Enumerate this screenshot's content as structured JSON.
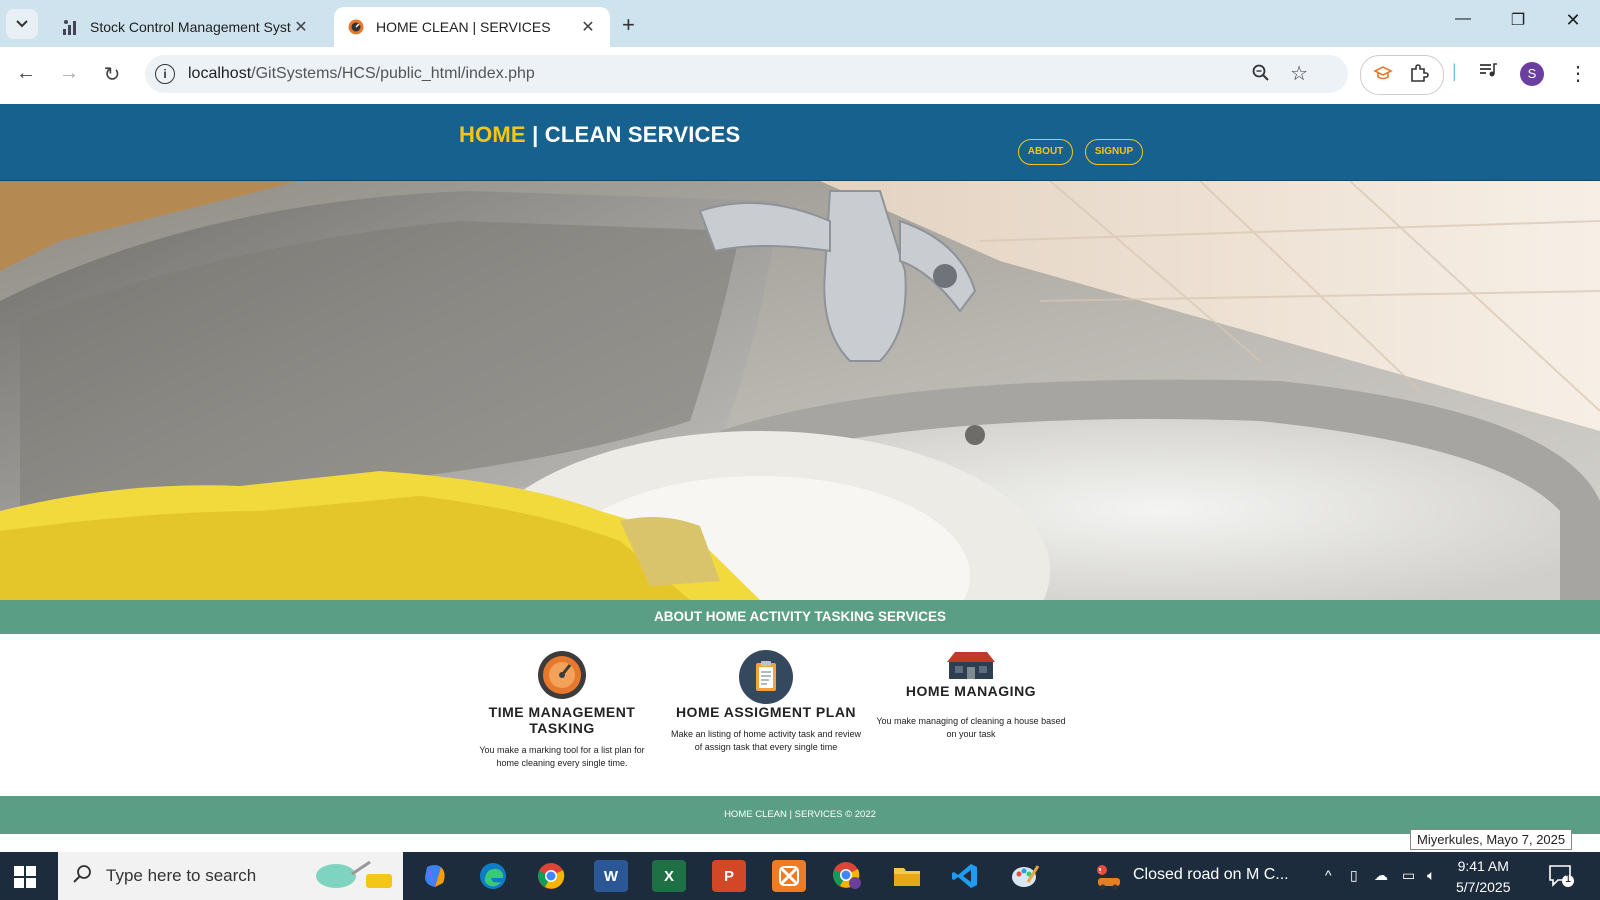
{
  "browser": {
    "tabs": [
      {
        "title": "Stock Control Management System",
        "active": false,
        "favicon": "bar-chart-icon"
      },
      {
        "title": "HOME CLEAN | SERVICES",
        "active": true,
        "favicon": "site-favicon-icon"
      }
    ],
    "url_host": "localhost",
    "url_path": "/GitSystems/HCS/public_html/index.php",
    "profile_initial": "S"
  },
  "site": {
    "logo_home": "HOME",
    "logo_rest": " | CLEAN SERVICES",
    "nav": [
      {
        "label": "ABOUT"
      },
      {
        "label": "SIGNUP"
      }
    ],
    "about_heading": "ABOUT HOME ACTIVITY TASKING SERVICES",
    "features": [
      {
        "title": "TIME MANAGEMENT TASKING",
        "text": "You make a marking tool for a list plan for home cleaning every single time.",
        "icon": "clock-icon"
      },
      {
        "title": "HOME ASSIGMENT PLAN",
        "text": "Make an listing of home activity task and review of assign task that every single time",
        "icon": "clipboard-icon"
      },
      {
        "title": "HOME MANAGING",
        "text": "You make managing of cleaning a house based on your task",
        "icon": "house-icon"
      }
    ],
    "footer": "HOME CLEAN | SERVICES © 2022"
  },
  "taskbar": {
    "search_placeholder": "Type here to search",
    "news": "Closed road on M C...",
    "time": "9:41 AM",
    "date": "5/7/2025",
    "date_tooltip": "Miyerkules, Mayo 7, 2025",
    "notification_count": "1"
  },
  "colors": {
    "header": "#17618f",
    "accent_yellow": "#f5c518",
    "band_green": "#5a9e86"
  }
}
